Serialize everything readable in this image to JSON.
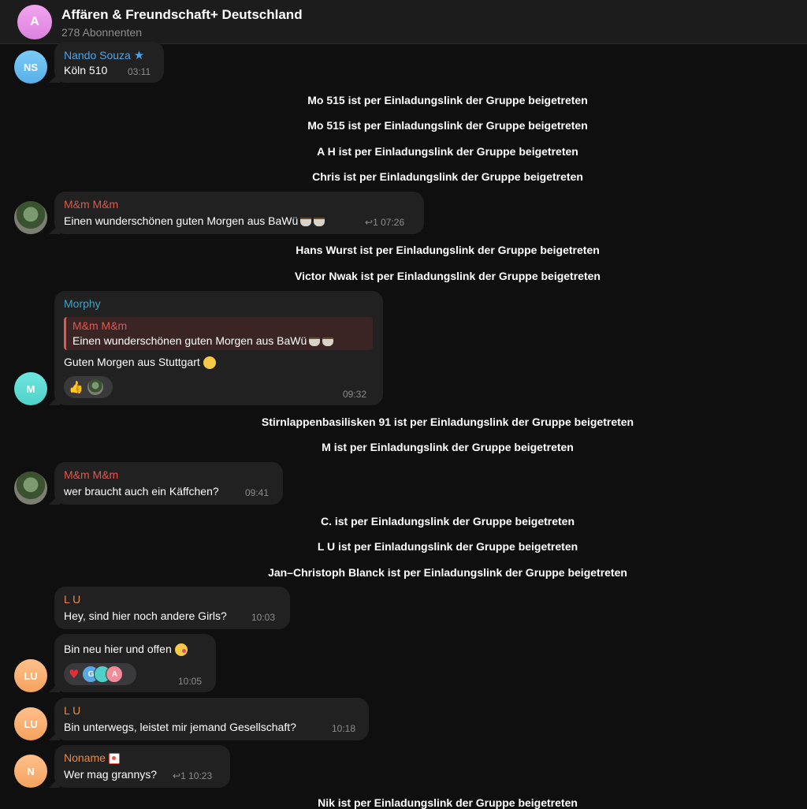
{
  "channel": {
    "avatar_letter": "A",
    "title": "Affären & Freundschaft+ Deutschland",
    "subscribers": "278 Abonnenten"
  },
  "messages": [
    {
      "avatar": "NS",
      "sender": "Nando Souza",
      "text": "Köln 510",
      "time": "03:11",
      "sender_icon": "star-icon"
    },
    {
      "avatar_type": "photo",
      "sender": "M&m M&m",
      "text": "Einen wunderschönen guten Morgen aus BaWü",
      "replies": "1",
      "time": "07:26"
    },
    {
      "avatar": "M",
      "sender": "Morphy",
      "quote_sender": "M&m M&m",
      "quote_text": "Einen wunderschönen guten Morgen aus BaWü",
      "text": "Guten Morgen aus Stuttgart",
      "reaction": "👍",
      "time": "09:32"
    },
    {
      "avatar_type": "photo",
      "sender": "M&m M&m",
      "text": "wer braucht auch ein Käffchen?",
      "time": "09:41"
    },
    {
      "sender": "L U",
      "text": "Hey, sind hier noch andere Girls?",
      "time": "10:03"
    },
    {
      "avatar": "LU",
      "text": "Bin neu hier und offen",
      "reaction": "♥",
      "reactor_letters": [
        "G",
        "",
        "A"
      ],
      "time": "10:05"
    },
    {
      "avatar": "LU",
      "sender": "L U",
      "text": "Bin unterwegs, leistet mir jemand Gesellschaft?",
      "time": "10:18"
    },
    {
      "avatar": "N",
      "sender": "Noname",
      "text": "Wer mag grannys?",
      "replies": "1",
      "time": "10:23"
    }
  ],
  "service": [
    "Mo 515 ist per Einladungslink der Gruppe beigetreten",
    "Mo 515 ist per Einladungslink der Gruppe beigetreten",
    "A H ist per Einladungslink der Gruppe beigetreten",
    "Chris ist per Einladungslink der Gruppe beigetreten",
    "Hans Wurst ist per Einladungslink der Gruppe beigetreten",
    "Victor Nwak ist per Einladungslink der Gruppe beigetreten",
    "Stirnlappenbasilisken 91 ist per Einladungslink der Gruppe beigetreten",
    "M ist per Einladungslink der Gruppe beigetreten",
    "C. ist per Einladungslink der Gruppe beigetreten",
    "L U ist per Einladungslink der Gruppe beigetreten",
    "Jan–Christoph Blanck ist per Einladungslink der Gruppe beigetreten",
    "Nik ist per Einladungslink der Gruppe beigetreten"
  ],
  "colors": {
    "background": "#0f0f0f",
    "bubble": "#212121",
    "sender_blue": "#4da3e6",
    "sender_red": "#e0584e",
    "sender_teal": "#3fa3c8",
    "sender_orange": "#e98a46"
  }
}
